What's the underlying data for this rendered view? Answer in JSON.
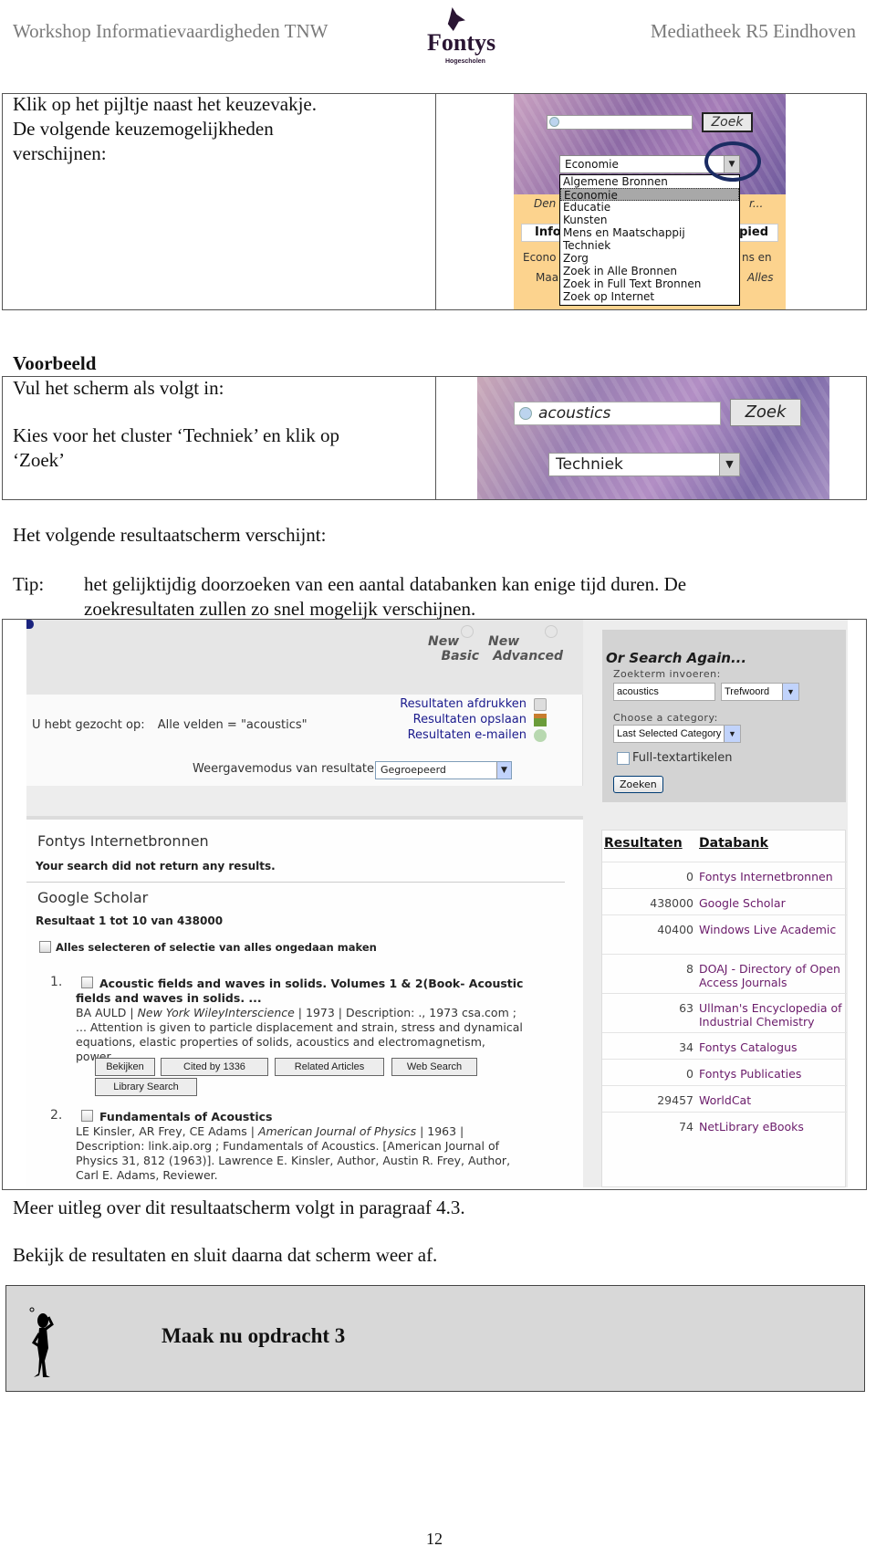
{
  "header": {
    "left_title": "Workshop Informatievaardigheden TNW",
    "logo_name": "Fontys",
    "logo_sub": "Hogescholen",
    "right_title": "Mediatheek R5 Eindhoven"
  },
  "step1": {
    "instruction_lines": [
      "Klik op het pijltje naast het keuzevakje.",
      "De volgende keuzemogelijkheden",
      "verschijnen:"
    ],
    "screenshot": {
      "search_button": "Zoek",
      "search_value": "",
      "selected_cluster": "Economie",
      "dropdown_options": [
        "Algemene Bronnen",
        "Economie",
        "Educatie",
        "Kunsten",
        "Mens en Maatschappij",
        "Techniek",
        "Zorg",
        "Zoek in Alle Bronnen",
        "Zoek in Full Text Bronnen",
        "Zoek op Internet"
      ],
      "highlighted_option": "Economie",
      "background_text": {
        "left_partial_1": "Den",
        "right_partial_1": "r...",
        "tab_left": "Info",
        "tab_right": "pied",
        "left_partial_2": "Econo",
        "right_partial_2": "ns en",
        "left_partial_3": "Maa",
        "right_partial_3": "Alles"
      }
    }
  },
  "example": {
    "heading": "Voorbeeld",
    "line1": "Vul het scherm als volgt in:",
    "line2": "Kies voor het cluster ‘Techniek’ en klik op",
    "line3": "‘Zoek’",
    "screenshot": {
      "search_value": "acoustics",
      "search_button": "Zoek",
      "selected_cluster": "Techniek"
    }
  },
  "result_intro": "Het volgende resultaatscherm verschijnt:",
  "tip": {
    "label": "Tip:",
    "line1": "het gelijktijdig doorzoeken van een aantal databanken kan enige tijd duren. De",
    "line2": "zoekresultaten zullen zo snel mogelijk verschijnen."
  },
  "results_screen": {
    "new_basic": [
      "New",
      "Basic"
    ],
    "new_advanced": [
      "New",
      "Advanced"
    ],
    "query_label": "U hebt gezocht op:",
    "query_value": "Alle velden = \"acoustics\"",
    "links": [
      "Resultaten afdrukken",
      "Resultaten opslaan",
      "Resultaten e-mailen"
    ],
    "display_mode_label": "Weergavemodus van resultaten:",
    "display_mode_value": "Gegroepeerd",
    "search_again": {
      "title": "Or Search Again...",
      "term_label": "Zoekterm invoeren:",
      "term_value": "acoustics",
      "field_select": "Trefwoord",
      "category_label": "Choose a category:",
      "category_value": "Last Selected Category",
      "fulltext_label": "Full-textartikelen",
      "fulltext_checked": false,
      "submit": "Zoeken"
    },
    "sections": [
      {
        "title": "Fontys Internetbronnen",
        "message": "Your search did not return any results."
      },
      {
        "title": "Google Scholar",
        "message": "Resultaat 1 tot 10 van 438000"
      }
    ],
    "select_all_label": "Alles selecteren of selectie van alles ongedaan maken",
    "records": [
      {
        "num": "1.",
        "title_lines": [
          "Acoustic fields and waves in solids. Volumes 1 & 2(Book- Acoustic",
          "fields and waves in solids. ..."
        ],
        "author": "BA AULD | ",
        "source": "New York WileyInterscience",
        "desc_lines": [
          " | 1973 | Description: ., 1973 csa.com ;",
          "... Attention is given to particle displacement and strain, stress and dynamical",
          "equations, elastic properties of solids, acoustics and electromagnetism,",
          "power ..."
        ],
        "buttons": [
          "Bekijken",
          "Cited by 1336",
          "Related Articles",
          "Web Search",
          "Library Search"
        ]
      },
      {
        "num": "2.",
        "title_lines": [
          "Fundamentals of Acoustics"
        ],
        "author": "LE Kinsler, AR Frey, CE Adams | ",
        "source": "American Journal of Physics",
        "desc_lines": [
          " | 1963 |",
          "Description: link.aip.org ; Fundamentals of Acoustics. [American Journal of",
          "Physics 31, 812 (1963)]. Lawrence E. Kinsler, Author, Austin R. Frey, Author,",
          "Carl E. Adams, Reviewer."
        ]
      }
    ],
    "table": {
      "col_results": "Resultaten",
      "col_database": "Databank",
      "rows": [
        {
          "count": "0",
          "db": "Fontys Internetbronnen"
        },
        {
          "count": "438000",
          "db": "Google Scholar"
        },
        {
          "count": "40400",
          "db": "Windows Live Academic"
        },
        {
          "count": "8",
          "db": "DOAJ - Directory of Open Access Journals"
        },
        {
          "count": "63",
          "db": "Ullman's Encyclopedia of Industrial Chemistry"
        },
        {
          "count": "34",
          "db": "Fontys Catalogus"
        },
        {
          "count": "0",
          "db": "Fontys Publicaties"
        },
        {
          "count": "29457",
          "db": "WorldCat"
        },
        {
          "count": "74",
          "db": "NetLibrary eBooks"
        }
      ]
    }
  },
  "after_text": {
    "line1": "Meer uitleg over dit resultaatscherm volgt in paragraaf 4.3.",
    "line2": "Bekijk de resultaten en sluit daarna dat scherm weer af."
  },
  "assignment": {
    "text": "Maak nu opdracht 3"
  },
  "page_number": "12"
}
